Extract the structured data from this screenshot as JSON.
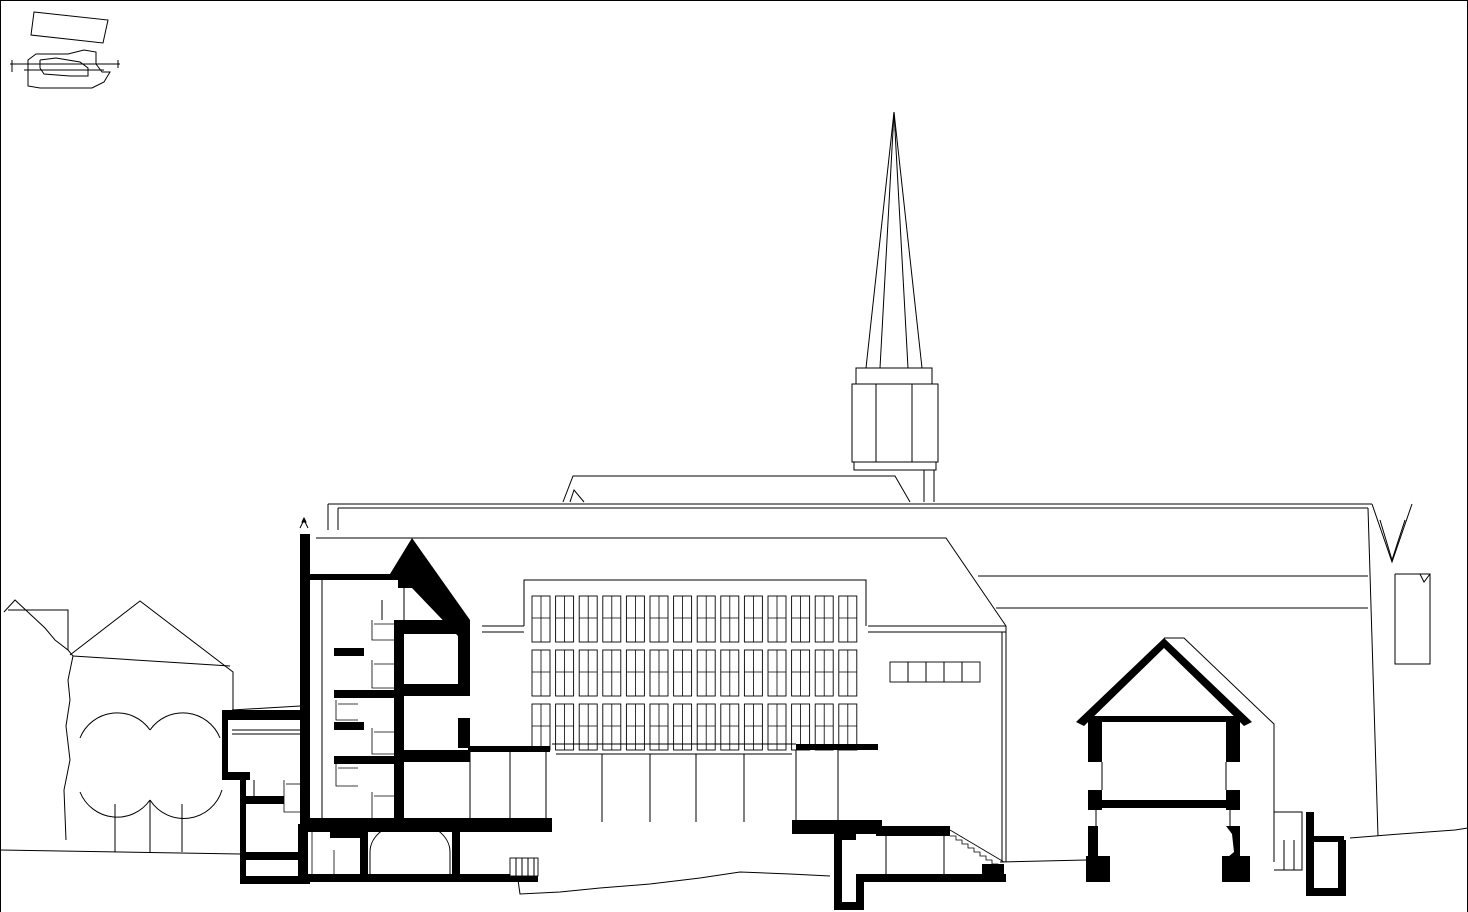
{
  "drawing": {
    "type": "architectural-section-elevation",
    "background_color": "#ffffff",
    "line_color": "#000000",
    "cut_fill_color": "#000000",
    "text_labels": []
  },
  "key_plan": {
    "shown": true
  },
  "components": [
    "frame",
    "key-plan",
    "neighbor-houses",
    "trees",
    "church-nave",
    "church-spire",
    "office-building",
    "sectioned-tower",
    "basement",
    "right-gabled-house",
    "ground-line"
  ]
}
